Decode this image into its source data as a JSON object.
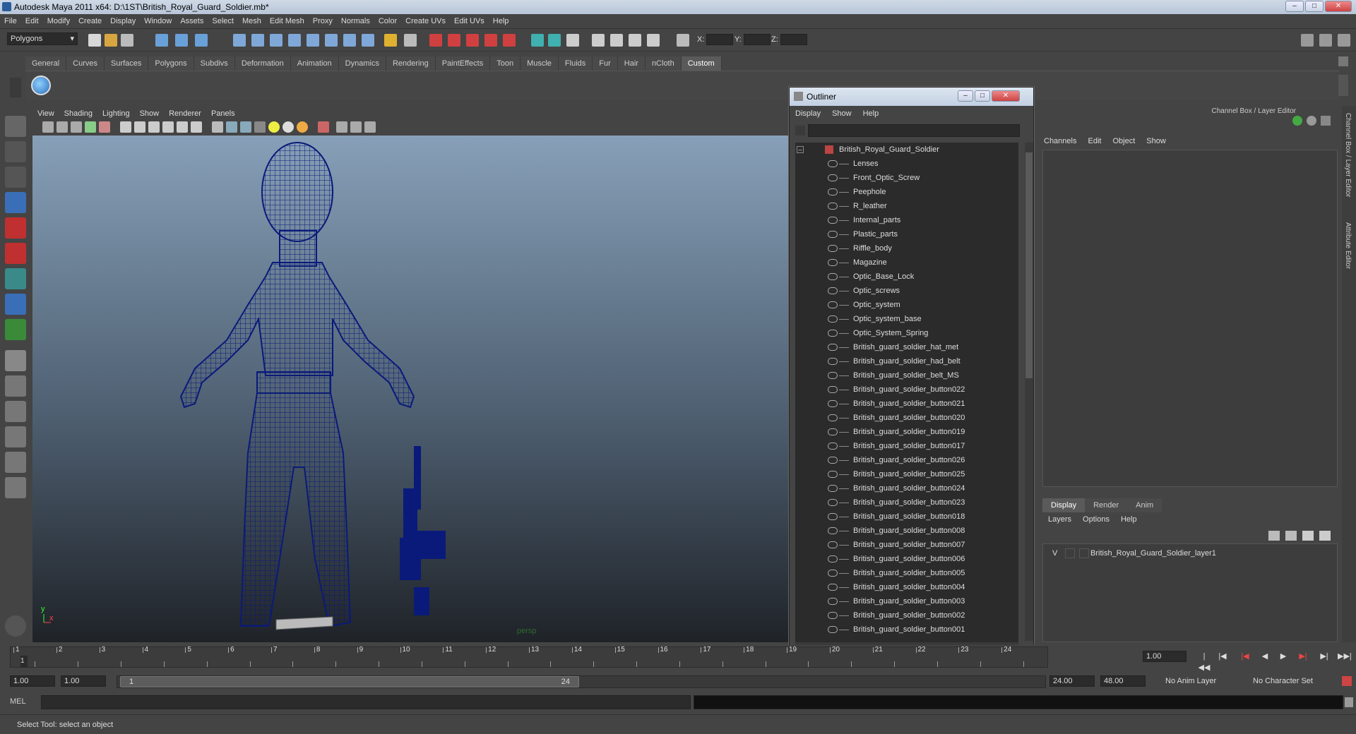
{
  "window": {
    "title": "Autodesk Maya 2011 x64: D:\\1ST\\British_Royal_Guard_Soldier.mb*"
  },
  "menubar": [
    "File",
    "Edit",
    "Modify",
    "Create",
    "Display",
    "Window",
    "Assets",
    "Select",
    "Mesh",
    "Edit Mesh",
    "Proxy",
    "Normals",
    "Color",
    "Create UVs",
    "Edit UVs",
    "Help"
  ],
  "statusline": {
    "mode": "Polygons",
    "x_label": "X:",
    "y_label": "Y:",
    "z_label": "Z:"
  },
  "shelf_tabs": [
    "General",
    "Curves",
    "Surfaces",
    "Polygons",
    "Subdivs",
    "Deformation",
    "Animation",
    "Dynamics",
    "Rendering",
    "PaintEffects",
    "Toon",
    "Muscle",
    "Fluids",
    "Fur",
    "Hair",
    "nCloth",
    "Custom"
  ],
  "shelf_active": "Custom",
  "viewport": {
    "menu": [
      "View",
      "Shading",
      "Lighting",
      "Show",
      "Renderer",
      "Panels"
    ],
    "camera_label": "persp",
    "axis": {
      "y": "y",
      "x": "x"
    }
  },
  "outliner": {
    "title": "Outliner",
    "menu": [
      "Display",
      "Show",
      "Help"
    ],
    "root": "British_Royal_Guard_Soldier",
    "items": [
      "Lenses",
      "Front_Optic_Screw",
      "Peephole",
      "R_leather",
      "Internal_parts",
      "Plastic_parts",
      "Riffle_body",
      "Magazine",
      "Optic_Base_Lock",
      "Optic_screws",
      "Optic_system",
      "Optic_system_base",
      "Optic_System_Spring",
      "British_guard_soldier_hat_met",
      "British_guard_soldier_had_belt",
      "British_guard_soldier_belt_MS",
      "British_guard_soldier_button022",
      "British_guard_soldier_button021",
      "British_guard_soldier_button020",
      "British_guard_soldier_button019",
      "British_guard_soldier_button017",
      "British_guard_soldier_button026",
      "British_guard_soldier_button025",
      "British_guard_soldier_button024",
      "British_guard_soldier_button023",
      "British_guard_soldier_button018",
      "British_guard_soldier_button008",
      "British_guard_soldier_button007",
      "British_guard_soldier_button006",
      "British_guard_soldier_button005",
      "British_guard_soldier_button004",
      "British_guard_soldier_button003",
      "British_guard_soldier_button002",
      "British_guard_soldier_button001"
    ]
  },
  "channel_box": {
    "header": "Channel Box / Layer Editor",
    "menu": [
      "Channels",
      "Edit",
      "Object",
      "Show"
    ],
    "layer_tabs": [
      "Display",
      "Render",
      "Anim"
    ],
    "layer_tab_active": "Display",
    "layer_menu": [
      "Layers",
      "Options",
      "Help"
    ],
    "layer": {
      "visible": "V",
      "name": "British_Royal_Guard_Soldier_layer1"
    },
    "side_tabs": [
      "Channel Box / Layer Editor",
      "Attribute Editor"
    ]
  },
  "timeslider": {
    "ticks": [
      "1",
      "2",
      "3",
      "4",
      "5",
      "6",
      "7",
      "8",
      "9",
      "10",
      "11",
      "12",
      "13",
      "14",
      "15",
      "16",
      "17",
      "18",
      "19",
      "20",
      "21",
      "22",
      "23",
      "24"
    ],
    "current_frame_marker": "1",
    "current_time": "1.00"
  },
  "range": {
    "start": "1.00",
    "playback_start": "1.00",
    "slider_start": "1",
    "slider_end": "24",
    "playback_end": "24.00",
    "end": "48.00",
    "anim_layer": "No Anim Layer",
    "character_set": "No Character Set"
  },
  "cmdline": {
    "label": "MEL"
  },
  "helpline": "Select Tool: select an object",
  "colors": {
    "wireframe": "#0a1a7a",
    "accent": "#5a5a5a"
  }
}
